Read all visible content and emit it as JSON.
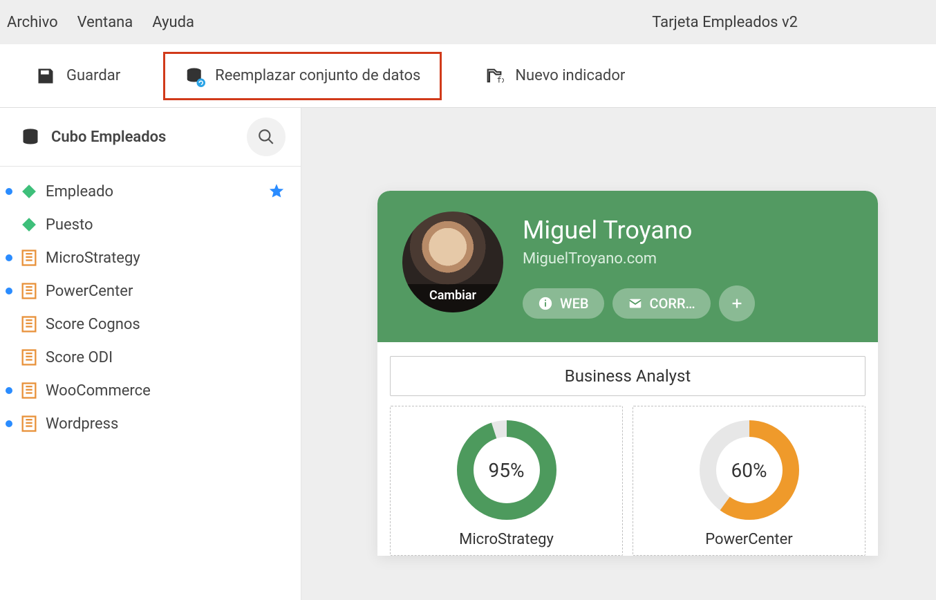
{
  "menubar": {
    "items": [
      "Archivo",
      "Ventana",
      "Ayuda"
    ],
    "title": "Tarjeta Empleados v2"
  },
  "toolbar": {
    "save": "Guardar",
    "replace": "Reemplazar conjunto de datos",
    "new_indicator": "Nuevo indicador"
  },
  "sidebar": {
    "cube_title": "Cubo Empleados",
    "items": [
      {
        "label": "Empleado",
        "icon": "diamond",
        "dot": true,
        "starred": true
      },
      {
        "label": "Puesto",
        "icon": "diamond",
        "dot": false,
        "starred": false
      },
      {
        "label": "MicroStrategy",
        "icon": "metric",
        "dot": true,
        "starred": false
      },
      {
        "label": "PowerCenter",
        "icon": "metric",
        "dot": true,
        "starred": false
      },
      {
        "label": "Score Cognos",
        "icon": "metric",
        "dot": false,
        "starred": false
      },
      {
        "label": "Score ODI",
        "icon": "metric",
        "dot": false,
        "starred": false
      },
      {
        "label": "WooCommerce",
        "icon": "metric",
        "dot": true,
        "starred": false
      },
      {
        "label": "Wordpress",
        "icon": "metric",
        "dot": true,
        "starred": false
      }
    ]
  },
  "card": {
    "name": "Miguel Troyano",
    "site": "MiguelTroyano.com",
    "avatar_overlay": "Cambiar",
    "chips": {
      "web": "WEB",
      "mail": "CORR…"
    },
    "role": "Business Analyst"
  },
  "chart_data": [
    {
      "type": "pie",
      "title": "MicroStrategy",
      "value": 95,
      "value_label": "95%",
      "color": "#4d9a5d",
      "track": "#e7e7e7"
    },
    {
      "type": "pie",
      "title": "PowerCenter",
      "value": 60,
      "value_label": "60%",
      "color": "#ef9a2b",
      "track": "#e7e7e7"
    }
  ]
}
